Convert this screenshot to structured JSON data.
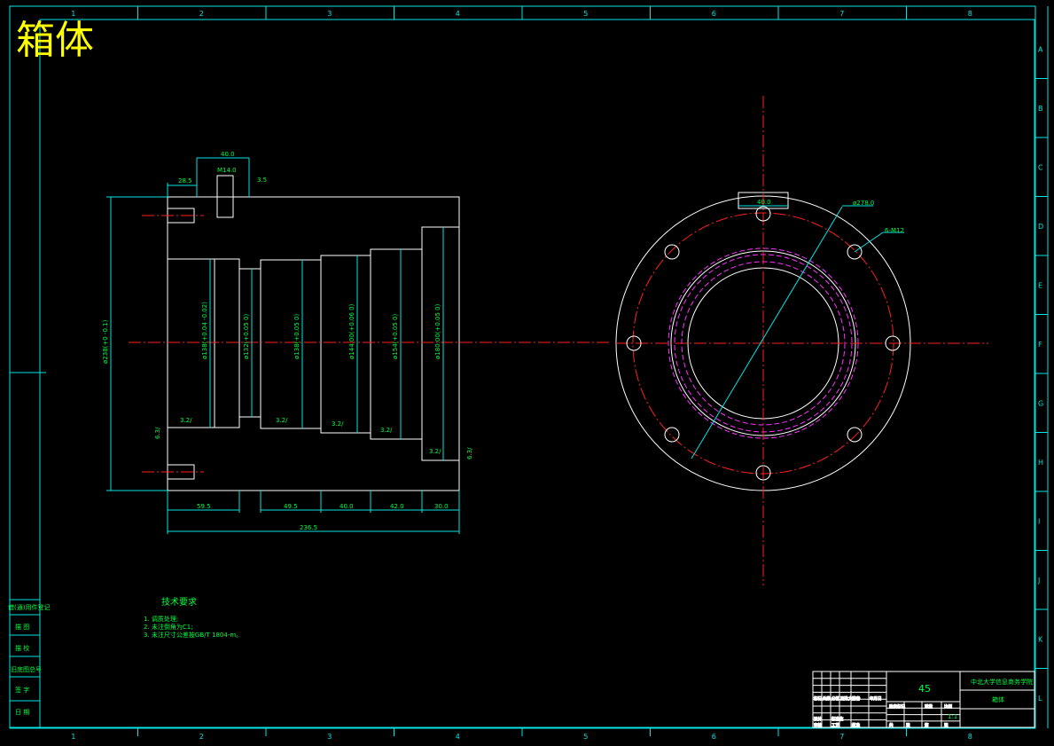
{
  "drawing_title": "箱体",
  "border": {
    "columns": [
      "1",
      "2",
      "3",
      "4",
      "5",
      "6",
      "7",
      "8"
    ],
    "rows": [
      "A",
      "B",
      "C",
      "D",
      "E",
      "F",
      "G",
      "H",
      "I",
      "J",
      "K",
      "L"
    ]
  },
  "section_view": {
    "dims_top": {
      "slot_width": "40.0",
      "slot_thread": "M14.0",
      "left_offset": "28.5",
      "slot_depth": "3.5"
    },
    "bores": [
      {
        "label": "ø138(+0.04 -0.02)"
      },
      {
        "label": "ø132(+0.05 0)"
      },
      {
        "label": "ø138(+0.05 0)"
      },
      {
        "label": "ø144.00(+0.06 0)"
      },
      {
        "label": "ø154(+0.05 0)"
      },
      {
        "label": "ø180.00(+0.05 0)"
      }
    ],
    "outer_diameter": "ø238(+0 -0.1)",
    "roughness": [
      "3.2/",
      "3.2/",
      "3.2/",
      "3.2/",
      "3.2/",
      "6.3/",
      "6.3/"
    ],
    "bottom_dims": [
      "59.5",
      "49.5",
      "40.0",
      "42.0",
      "30.0"
    ],
    "overall_length": "236.5"
  },
  "end_view": {
    "slot_width": "40.0",
    "pcd_label": "ø278.0",
    "hole_label": "6-M12"
  },
  "tech_requirements": {
    "heading": "技术要求",
    "items": [
      "1. 调质处理;",
      "2. 未注倒角为C1;",
      "3. 未注尺寸公差按GB/T 1804-m。"
    ]
  },
  "left_stamps": [
    "借(通)用件登记",
    "描 图",
    "描 校",
    "旧底图总号",
    "签 字",
    "日 期"
  ],
  "title_block": {
    "material": "45",
    "school": "中北大学信息商务学院",
    "part_name": "箱体",
    "scale": "1:1",
    "labels": [
      "标记",
      "处数",
      "分区",
      "更改文件号",
      "签名",
      "年月日",
      "设计",
      "标准化",
      "审核",
      "工艺",
      "批准",
      "阶段标记",
      "重量",
      "比例",
      "共",
      "张",
      "第",
      "张"
    ]
  },
  "colors": {
    "frame": "#00e5e5",
    "outline": "#ffffff",
    "centerline": "#ff2020",
    "hidden": "#ff30ff",
    "text": "#00ff40",
    "title": "#ffff00",
    "hatch": "#d8d860"
  }
}
